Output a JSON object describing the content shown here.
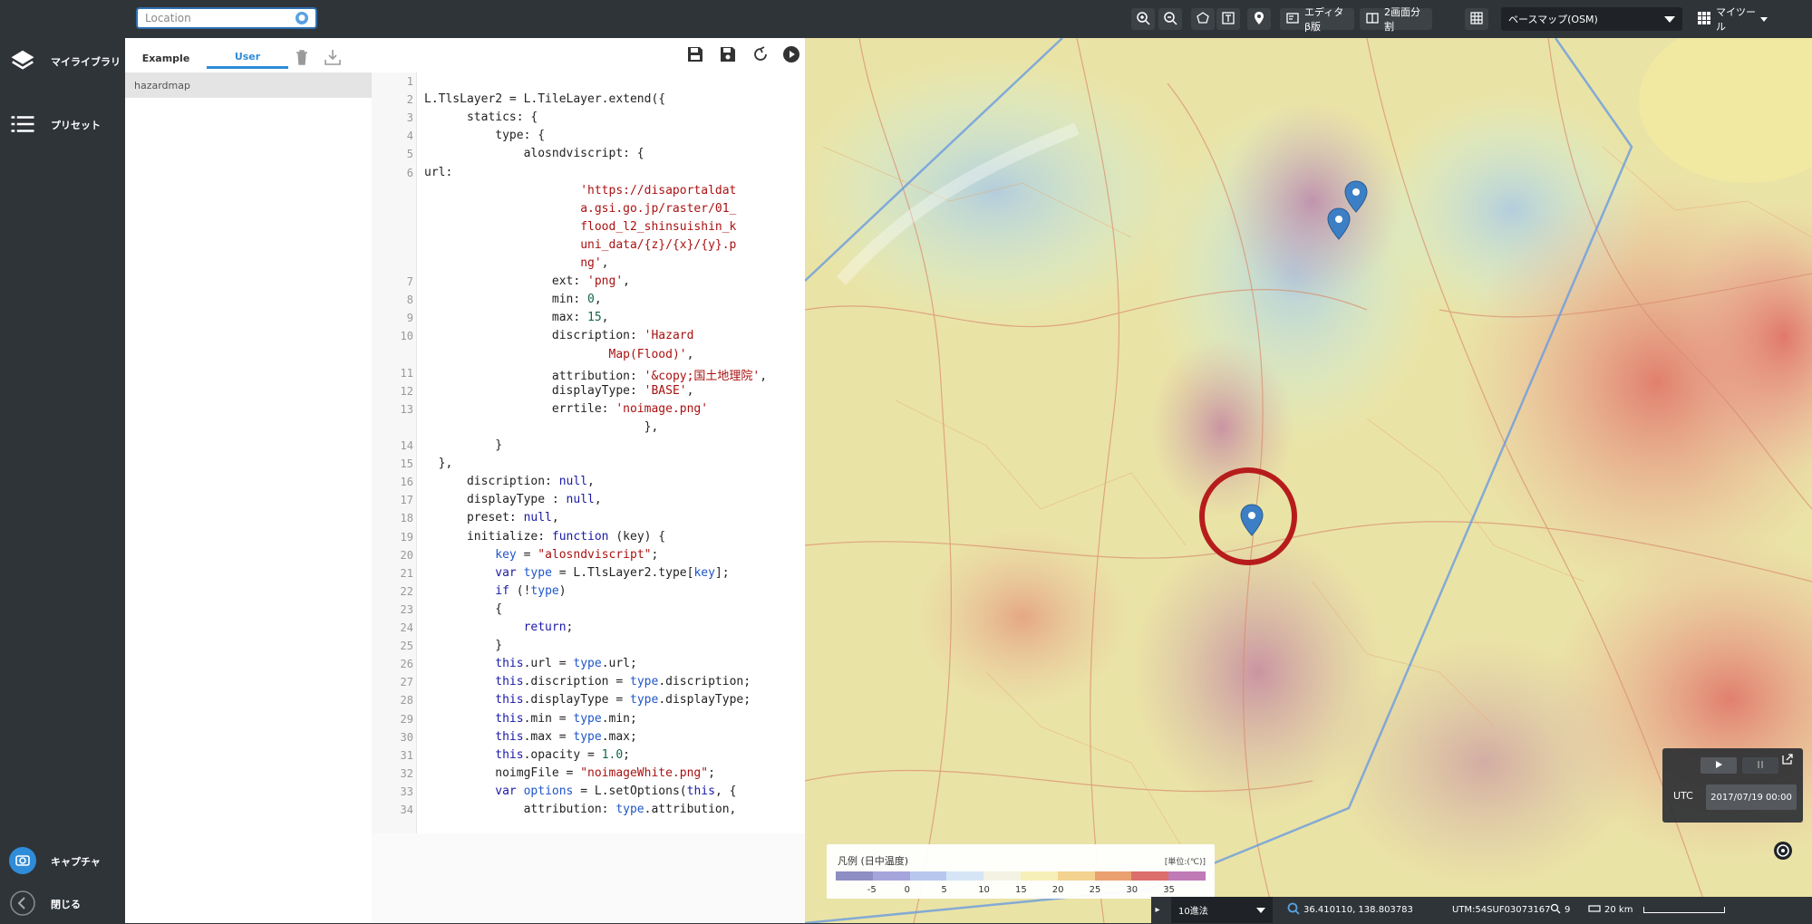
{
  "nav": {
    "library_label": "マイライブラリ",
    "preset_label": "プリセット",
    "capture_label": "キャプチャ",
    "close_label": "閉じる"
  },
  "topbar": {
    "location_placeholder": "Location",
    "editor_label": "エディタβ版",
    "split_label": "2画面分割",
    "basemap_value": "ベースマップ(OSM)",
    "mytools_label": "マイツール"
  },
  "library": {
    "tabs": [
      "Example",
      "User"
    ],
    "active_tab": "User",
    "items": [
      "hazardmap"
    ]
  },
  "editor": {
    "line_numbers": [
      "1",
      "2",
      "3",
      "4",
      "5",
      "6",
      "",
      "",
      "",
      "",
      "",
      "7",
      "8",
      "9",
      "10",
      "",
      "11",
      "12",
      "13",
      "",
      "14",
      "15",
      "16",
      "17",
      "18",
      "19",
      "20",
      "21",
      "22",
      "23",
      "24",
      "25",
      "26",
      "27",
      "28",
      "29",
      "30",
      "31",
      "32",
      "33",
      "34"
    ]
  },
  "map": {
    "legend_title": "凡例 (日中温度)",
    "legend_unit": "[単位:(℃)]",
    "legend_ticks": [
      "-5",
      "0",
      "5",
      "10",
      "15",
      "20",
      "25",
      "30",
      "35"
    ],
    "legend_colors": [
      "#8e8ec4",
      "#a5a5dc",
      "#b7c7ee",
      "#d6e5f6",
      "#f3f2e3",
      "#f6efb7",
      "#f3d38f",
      "#eaa06f",
      "#dc6f6b",
      "#c07ab6"
    ],
    "timezone_label": "UTC",
    "datetime_value": "2017/07/19 00:00",
    "coord_system": "10進法",
    "coordinates": "36.410110, 138.803783",
    "utm": "UTM:54SUF03073167",
    "zoom": "9",
    "scale": "20 km"
  },
  "colors": {
    "dark": "#2f3439",
    "accent": "#2f8cd8",
    "marker": "#3d7fc4",
    "circle": "#b71c1c"
  }
}
